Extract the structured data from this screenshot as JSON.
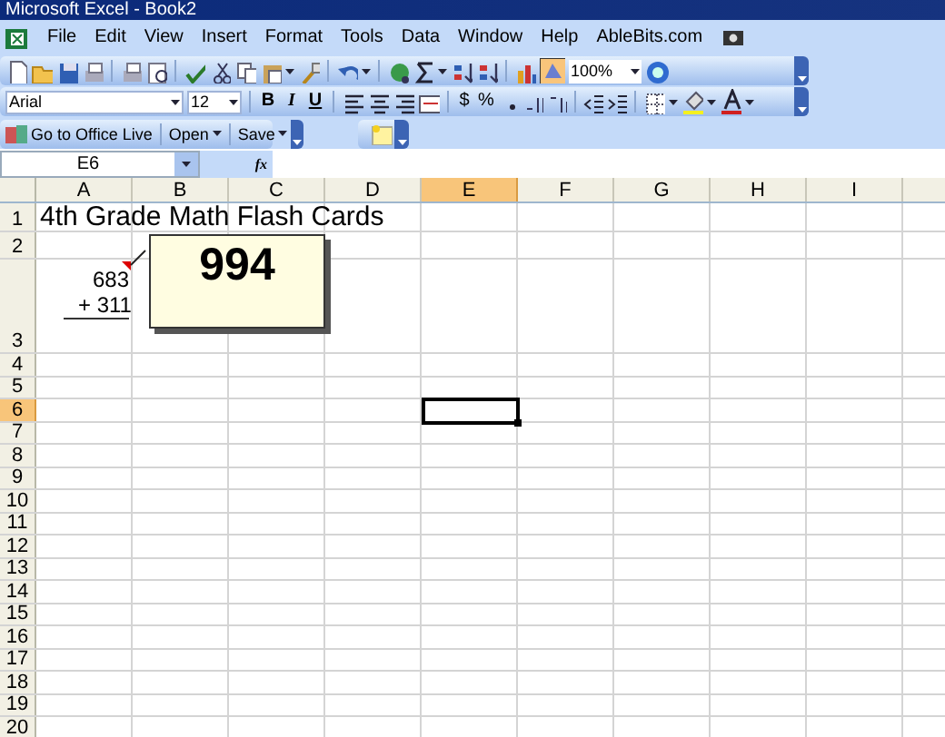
{
  "window": {
    "title": "Microsoft Excel - Book2"
  },
  "menu": [
    {
      "label": "File"
    },
    {
      "label": "Edit"
    },
    {
      "label": "View"
    },
    {
      "label": "Insert"
    },
    {
      "label": "Format"
    },
    {
      "label": "Tools"
    },
    {
      "label": "Data"
    },
    {
      "label": "Window"
    },
    {
      "label": "Help"
    },
    {
      "label": "AbleBits.com"
    }
  ],
  "standard_toolbar": {
    "zoom": "100%"
  },
  "formatting_toolbar": {
    "font": "Arial",
    "size": "12",
    "bold": "B",
    "italic": "I",
    "underline": "U",
    "currency": "$",
    "percent": "%"
  },
  "office_live_toolbar": {
    "go": "Go to Office Live",
    "open": "Open",
    "save": "Save"
  },
  "formula_bar": {
    "name_box": "E6",
    "fx": "fx"
  },
  "columns": [
    {
      "label": "A",
      "selected": false
    },
    {
      "label": "B",
      "selected": false
    },
    {
      "label": "C",
      "selected": false
    },
    {
      "label": "D",
      "selected": false
    },
    {
      "label": "E",
      "selected": true
    },
    {
      "label": "F",
      "selected": false
    },
    {
      "label": "G",
      "selected": false
    },
    {
      "label": "H",
      "selected": false
    },
    {
      "label": "I",
      "selected": false
    }
  ],
  "rows": [
    {
      "label": "1",
      "selected": false,
      "cells": [
        {
          "lines": [
            "4th Grade Math Flash Cards"
          ]
        }
      ]
    },
    {
      "label": "2",
      "selected": false
    },
    {
      "label": "3",
      "selected": false,
      "cells": [
        {
          "lines": [
            "683",
            "+ 311"
          ],
          "underlined": true
        }
      ]
    },
    {
      "label": "4",
      "selected": false
    },
    {
      "label": "5",
      "selected": false
    },
    {
      "label": "6",
      "selected": true
    },
    {
      "label": "7",
      "selected": false
    },
    {
      "label": "8",
      "selected": false
    },
    {
      "label": "9",
      "selected": false
    },
    {
      "label": "10",
      "selected": false
    },
    {
      "label": "11",
      "selected": false
    },
    {
      "label": "12",
      "selected": false
    },
    {
      "label": "13",
      "selected": false
    },
    {
      "label": "14",
      "selected": false
    },
    {
      "label": "15",
      "selected": false
    },
    {
      "label": "16",
      "selected": false
    },
    {
      "label": "17",
      "selected": false
    },
    {
      "label": "18",
      "selected": false
    },
    {
      "label": "19",
      "selected": false
    },
    {
      "label": "20",
      "selected": false
    }
  ],
  "comment": {
    "text": "994"
  }
}
